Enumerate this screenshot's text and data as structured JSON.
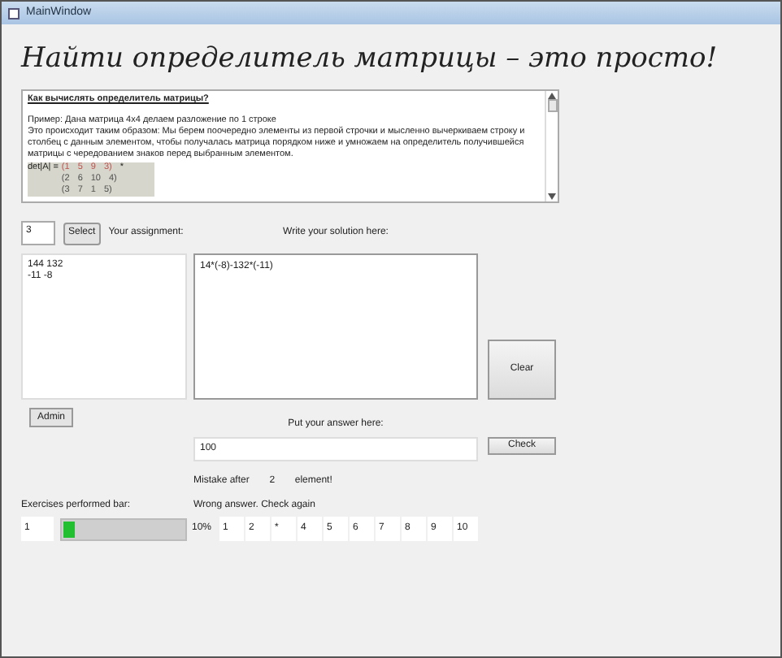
{
  "window": {
    "title": "MainWindow"
  },
  "heading": "Найти определитель матрицы – это просто!",
  "help": {
    "title": "Как вычислять определитель матрицы?",
    "paragraphs": [
      "Пример: Дана матрица 4х4 делаем разложение по 1 строке",
      "Это происходит таким образом: Мы берем поочередно элементы из первой строчки и мысленно вычеркиваем строку и столбец с данным элементом, чтобы получалась матрица порядком ниже и умножаем на определитель получившейся матрицы с чередованием знаков перед выбранным элементом."
    ],
    "matrix_label": "det|A| =",
    "matrix_rows": [
      {
        "cells": [
          "(1",
          "5",
          "9",
          "3)"
        ],
        "suffix": "*",
        "highlighted": true
      },
      {
        "cells": [
          "(2",
          "6",
          "10",
          "4)"
        ],
        "highlighted": false
      },
      {
        "cells": [
          "(3",
          "7",
          "1",
          "5)"
        ],
        "highlighted": false
      }
    ]
  },
  "assignment_number": "3",
  "select_button": "Select",
  "assignment_label": "Your assignment:",
  "solution_label": "Write your solution here:",
  "assignment_text": [
    "144 132",
    "-11 -8"
  ],
  "solution_text": "14*(-8)-132*(-11)",
  "clear_button": "Clear",
  "admin_button": "Admin",
  "answer_label": "Put your answer here:",
  "answer_value": "100",
  "check_button": "Check",
  "mistake": {
    "prefix": "Mistake after",
    "value": "2",
    "suffix": "element!"
  },
  "result_message": "Wrong answer. Check again",
  "progress": {
    "label": "Exercises performed bar:",
    "count": "1",
    "level": 0.1,
    "percent": "10%"
  },
  "steps": [
    "1",
    "2",
    "*",
    "4",
    "5",
    "6",
    "7",
    "8",
    "9",
    "10"
  ]
}
